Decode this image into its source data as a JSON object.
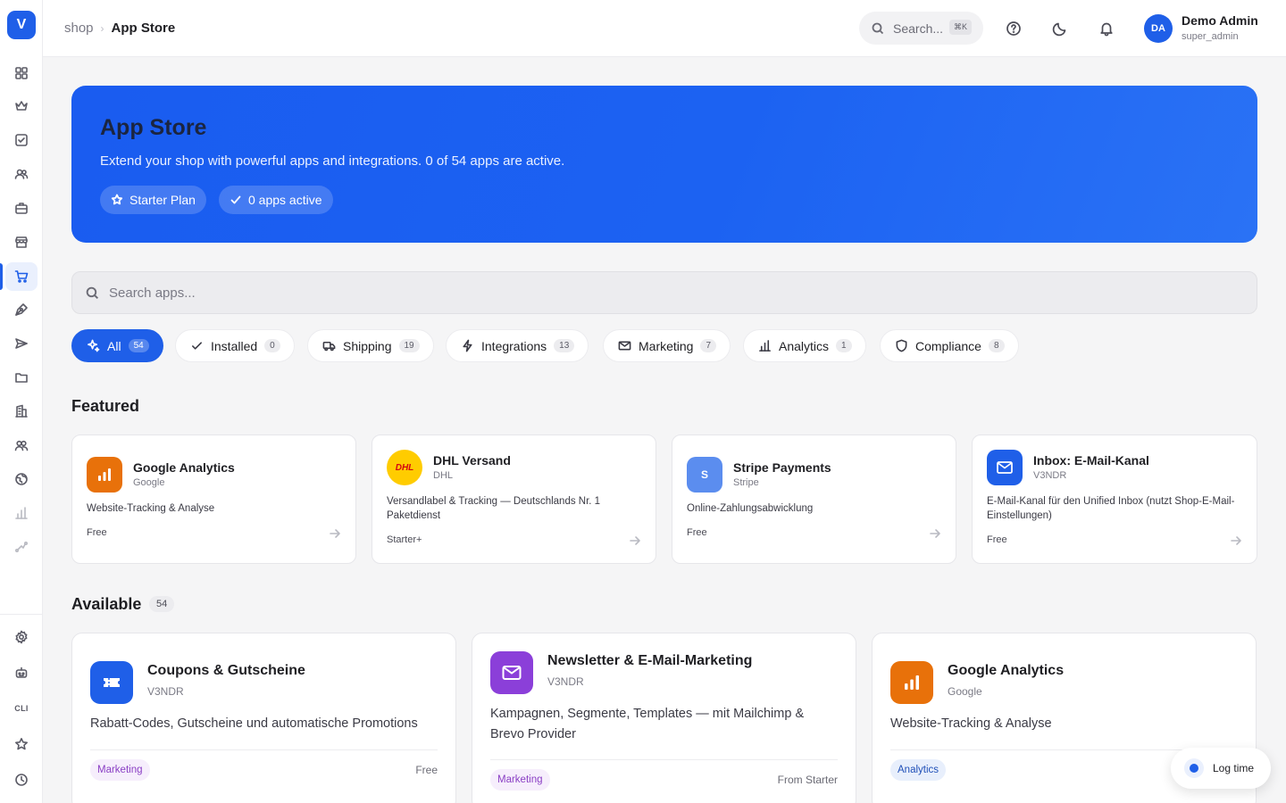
{
  "sidebar": {
    "logo": "V",
    "cli": "CLI",
    "icons": [
      "dashboard-icon",
      "crown-icon",
      "checkbox-icon",
      "users-icon",
      "briefcase-icon",
      "store-icon",
      "cart-icon",
      "pen-tool-icon",
      "send-icon",
      "folder-icon",
      "building-icon",
      "team-icon",
      "globe-icon",
      "bar-chart-icon",
      "trend-icon",
      "settings-icon",
      "bot-icon",
      "cli-icon",
      "star-icon",
      "clock-icon"
    ],
    "active": "cart-icon"
  },
  "topbar": {
    "breadcrumb": {
      "parent": "shop",
      "current": "App Store"
    },
    "search_label": "Search...",
    "search_kbd": "⌘K",
    "user": {
      "initials": "DA",
      "name": "Demo Admin",
      "role": "super_admin"
    }
  },
  "hero": {
    "title": "App Store",
    "subtitle": "Extend your shop with powerful apps and integrations. 0 of 54 apps are active.",
    "plan_label": "Starter Plan",
    "active_label": "0 apps active"
  },
  "app_search": {
    "placeholder": "Search apps..."
  },
  "filters": [
    {
      "label": "All",
      "count": "54",
      "icon": "sparkle-icon",
      "active": true
    },
    {
      "label": "Installed",
      "count": "0",
      "icon": "check-icon"
    },
    {
      "label": "Shipping",
      "count": "19",
      "icon": "truck-icon"
    },
    {
      "label": "Integrations",
      "count": "13",
      "icon": "bolt-icon"
    },
    {
      "label": "Marketing",
      "count": "7",
      "icon": "mail-icon"
    },
    {
      "label": "Analytics",
      "count": "1",
      "icon": "bar-chart-icon"
    },
    {
      "label": "Compliance",
      "count": "8",
      "icon": "shield-icon"
    }
  ],
  "featured": {
    "title": "Featured",
    "apps": [
      {
        "name": "Google Analytics",
        "vendor": "Google",
        "description": "Website-Tracking & Analyse",
        "price": "Free",
        "icon": "analytics-icon",
        "color": "#e8710a"
      },
      {
        "name": "DHL Versand",
        "vendor": "DHL",
        "description": "Versandlabel & Tracking — Deutschlands Nr. 1 Paketdienst",
        "price": "Starter+",
        "icon": "dhl-logo-icon",
        "logo_text": "DHL",
        "color": "#ffcc00"
      },
      {
        "name": "Stripe Payments",
        "vendor": "Stripe",
        "description": "Online-Zahlungsabwicklung",
        "price": "Free",
        "icon": "stripe-icon",
        "logo_text": "S",
        "color": "#5b8def"
      },
      {
        "name": "Inbox: E-Mail-Kanal",
        "vendor": "V3NDR",
        "description": "E-Mail-Kanal für den Unified Inbox (nutzt Shop-E-Mail-Einstellungen)",
        "price": "Free",
        "icon": "mail-icon",
        "color": "#1f5fe8"
      }
    ]
  },
  "available": {
    "title": "Available",
    "count": "54",
    "apps": [
      {
        "name": "Coupons & Gutscheine",
        "vendor": "V3NDR",
        "description": "Rabatt-Codes, Gutscheine und automatische Promotions",
        "tag": "Marketing",
        "price": "Free",
        "icon": "ticket-icon",
        "color": "#1f5fe8"
      },
      {
        "name": "Newsletter & E-Mail-Marketing",
        "vendor": "V3NDR",
        "description": "Kampagnen, Segmente, Templates — mit Mailchimp & Brevo Provider",
        "tag": "Marketing",
        "price": "From Starter",
        "icon": "mail-icon",
        "color": "#8b3fd9"
      },
      {
        "name": "Google Analytics",
        "vendor": "Google",
        "description": "Website-Tracking & Analyse",
        "tag": "Analytics",
        "price": "",
        "icon": "analytics-icon",
        "color": "#e8710a"
      }
    ]
  },
  "log_time": {
    "label": "Log time"
  }
}
